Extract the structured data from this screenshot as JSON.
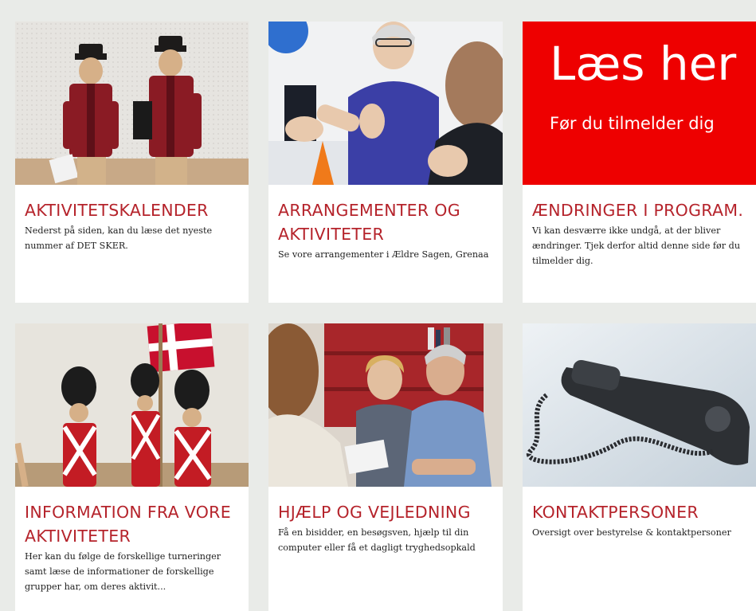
{
  "cards": [
    {
      "title": "AKTIVITETSKALENDER",
      "description": "Nederst på siden, kan du læse det nyeste nummer af DET SKER.",
      "image": "toy-postmen-figures"
    },
    {
      "title": "ARRANGEMENTER OG AKTIVITETER",
      "description": "Se vore arrangementer i Ældre Sagen, Grenaa",
      "image": "senior-woman-exercising"
    },
    {
      "title": "ÆNDRINGER I PROGRAM.",
      "description": "Vi kan desværre ikke undgå, at der bliver ændringer. Tjek derfor altid denne side før du tilmelder dig.",
      "image": "red-notice-banner",
      "image_heading": "Læs her",
      "image_subheading": "Før du tilmelder dig"
    },
    {
      "title": "INFORMATION FRA VORE AKTIVITETER",
      "description": "Her kan du følge de forskellige turneringer samt læse de informationer de forskellige grupper har, om deres aktivit...",
      "image": "toy-guards-with-flag"
    },
    {
      "title": "HJÆLP OG VEJLEDNING",
      "description": "Få en bisidder, en besøgsven, hjælp til din computer eller få et dagligt tryghedsopkald",
      "image": "senior-couple-consultation"
    },
    {
      "title": "KONTAKTPERSONER",
      "description": "Oversigt over bestyrelse & kontaktpersoner",
      "image": "telephone-handset"
    }
  ],
  "colors": {
    "accent": "#b5232b",
    "page_background": "#e9ebe8",
    "card_background": "#ffffff",
    "notice_red": "#ee0000"
  }
}
